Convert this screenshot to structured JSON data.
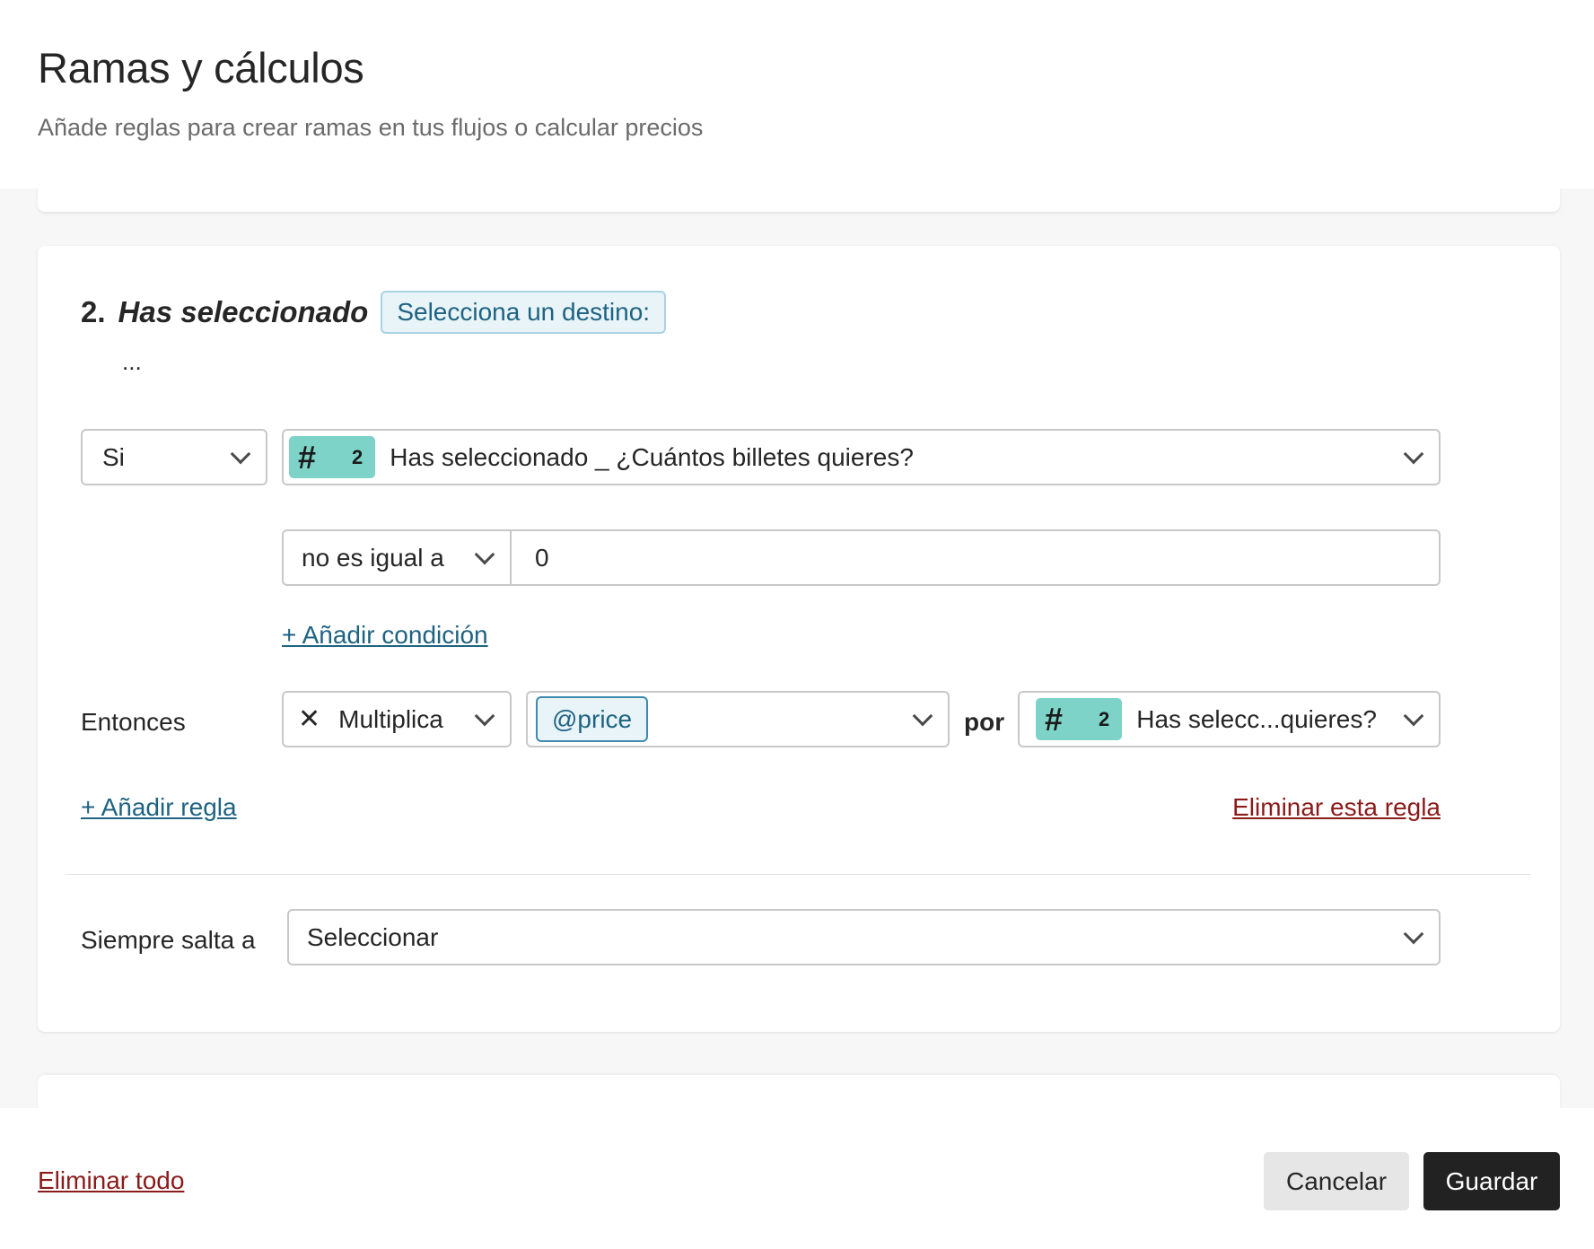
{
  "header": {
    "title": "Ramas y cálculos",
    "subtitle": "Añade reglas para crear ramas en tus flujos o calcular precios"
  },
  "rule": {
    "number": "2.",
    "name": "Has seleccionado",
    "destination_chip": "Selecciona un destino:",
    "ellipsis": "...",
    "condition": {
      "if_select": "Si",
      "field_badge_number": "2",
      "field_select": "Has seleccionado _ ¿Cuántos billetes quieres?",
      "operator": "no es igual a",
      "value": "0"
    },
    "add_condition": "+ Añadir condición",
    "then_label": "Entonces",
    "action_icon": "times-icon",
    "action": "Multiplica",
    "price_chip": "@price",
    "por_label": "por",
    "operand_badge_number": "2",
    "operand_select": "Has selecc...quieres?",
    "add_rule": "+ Añadir regla",
    "delete_rule": "Eliminar esta regla",
    "always_jump_label": "Siempre salta a",
    "always_jump_select": "Seleccionar"
  },
  "footer": {
    "delete_all": "Eliminar todo",
    "cancel": "Cancelar",
    "save": "Guardar"
  },
  "colors": {
    "badge": "#7dd3c8",
    "link": "#1f6382",
    "danger": "#8b1a1a",
    "primary_button": "#222222"
  }
}
